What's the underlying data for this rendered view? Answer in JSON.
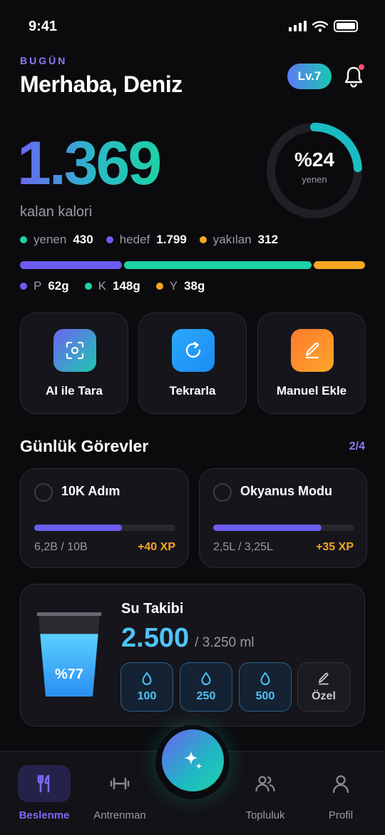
{
  "status_bar": {
    "time": "9:41"
  },
  "header": {
    "eyebrow": "BUGÜN",
    "greeting": "Merhaba, Deniz",
    "level": "Lv.7",
    "has_notification": true
  },
  "calories": {
    "remaining": "1.369",
    "remaining_label": "kalan kalori",
    "ring_percent_label": "%24",
    "ring_percent_value": 0.24,
    "ring_sub": "yenen",
    "legend": [
      {
        "label": "yenen",
        "value": "430",
        "color": "#1fd1a6"
      },
      {
        "label": "hedef",
        "value": "1.799",
        "color": "#6c5cf0"
      },
      {
        "label": "yakılan",
        "value": "312",
        "color": "#f5a623"
      }
    ]
  },
  "macros": {
    "segments": [
      {
        "share": 0.3,
        "color": "#6c5cf0"
      },
      {
        "share": 0.55,
        "color": "#1fd1a6"
      },
      {
        "share": 0.15,
        "color": "#f5a623"
      }
    ],
    "items": [
      {
        "label": "P",
        "value": "62g",
        "color": "#6c5cf0"
      },
      {
        "label": "K",
        "value": "148g",
        "color": "#1fd1a6"
      },
      {
        "label": "Y",
        "value": "38g",
        "color": "#f5a623"
      }
    ]
  },
  "quick_actions": [
    {
      "label": "AI ile Tara",
      "icon": "scan-icon"
    },
    {
      "label": "Tekrarla",
      "icon": "repeat-icon"
    },
    {
      "label": "Manuel Ekle",
      "icon": "pencil-icon"
    }
  ],
  "quests": {
    "title": "Günlük Görevler",
    "count": "2/4",
    "items": [
      {
        "title": "10K Adım",
        "progress_text": "6,2B / 10B",
        "xp": "+40 XP",
        "progress": 0.62
      },
      {
        "title": "Okyanus Modu",
        "progress_text": "2,5L / 3,25L",
        "xp": "+35 XP",
        "progress": 0.77
      }
    ]
  },
  "water": {
    "title": "Su Takibi",
    "current": "2.500",
    "target": "/ 3.250 ml",
    "percent_label": "%77",
    "percent_value": 0.77,
    "buttons": [
      {
        "label": "100",
        "icon": "water-drop-icon"
      },
      {
        "label": "250",
        "icon": "water-drop-icon"
      },
      {
        "label": "500",
        "icon": "water-drop-icon"
      },
      {
        "label": "Özel",
        "icon": "pencil-icon"
      }
    ]
  },
  "tabbar": {
    "active": "Beslenme",
    "tabs": [
      {
        "label": "Beslenme",
        "icon": "fork-knife-icon"
      },
      {
        "label": "Antrenman",
        "icon": "dumbbell-icon"
      },
      {
        "label": "Topluluk",
        "icon": "people-icon"
      },
      {
        "label": "Profil",
        "icon": "person-icon"
      }
    ],
    "fab_icon": "sparkle-icon"
  }
}
